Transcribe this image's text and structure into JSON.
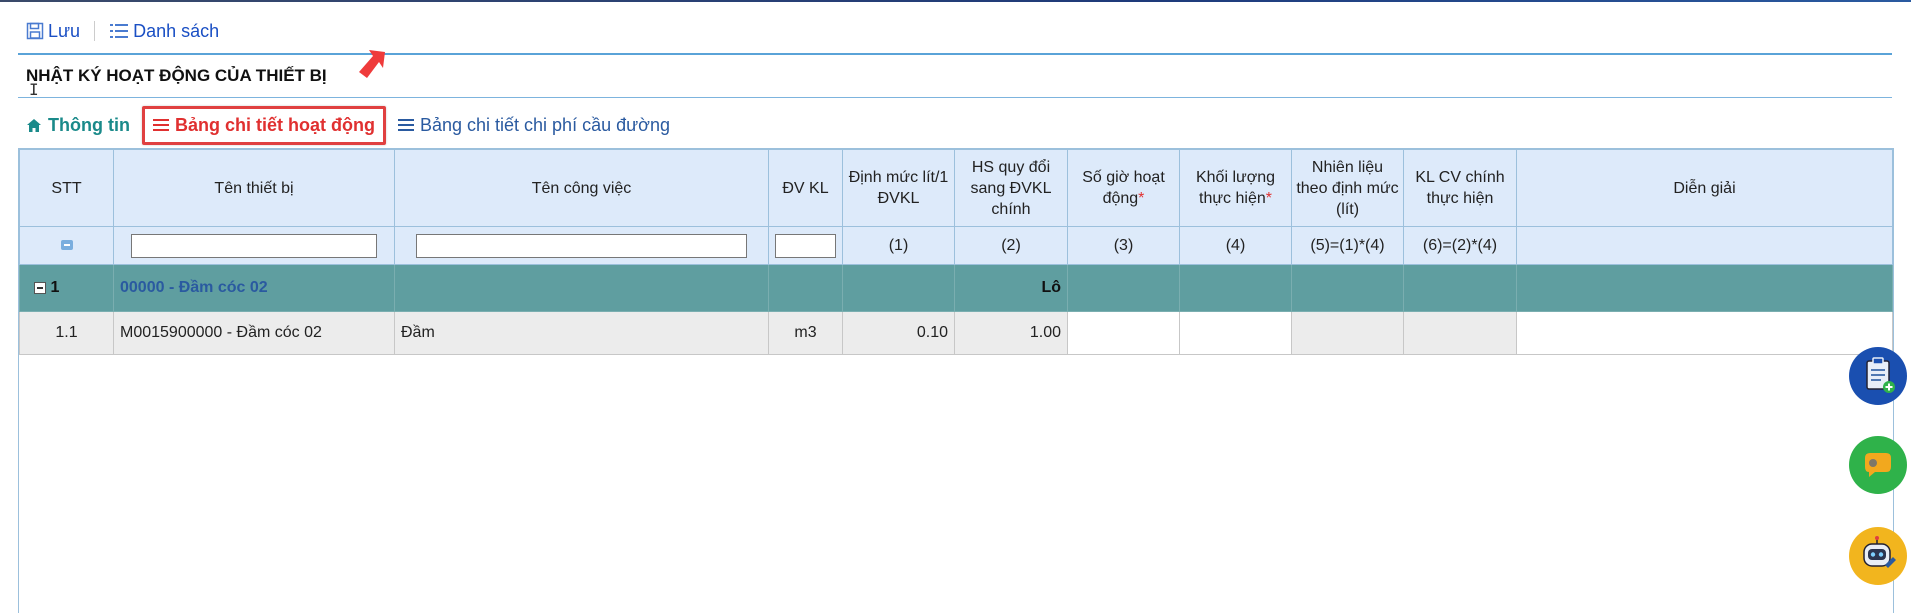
{
  "toolbar": {
    "save_label": "Lưu",
    "list_label": "Danh sách"
  },
  "page_title": "NHẬT KÝ HOẠT ĐỘNG CỦA THIẾT BỊ",
  "tabs": [
    {
      "label": "Thông tin",
      "icon": "home-icon"
    },
    {
      "label": "Bảng chi tiết hoạt động",
      "icon": "list-icon"
    },
    {
      "label": "Bảng chi tiết chi phí cầu đường",
      "icon": "list-icon"
    }
  ],
  "table": {
    "headers": {
      "stt": "STT",
      "device": "Tên thiết bị",
      "work": "Tên công việc",
      "unit": "ĐV KL",
      "norm": "Định mức lít/1 ĐVKL",
      "coef": "HS quy đổi sang ĐVKL chính",
      "hours": "Số giờ hoạt động",
      "volume": "Khối lượng thực hiện",
      "fuel": "Nhiên liệu theo định mức (lít)",
      "klcv": "KL CV chính thực hiện",
      "desc": "Diễn giải"
    },
    "required_mark": "*",
    "filter_row": {
      "norm": "(1)",
      "coef": "(2)",
      "hours": "(3)",
      "volume": "(4)",
      "fuel": "(5)=(1)*(4)",
      "klcv": "(6)=(2)*(4)"
    },
    "group": {
      "stt": "1",
      "name": "00000 - Đầm cóc 02",
      "lot": "Lô"
    },
    "rows": [
      {
        "stt": "1.1",
        "device": "M0015900000 - Đầm cóc 02",
        "work": "Đầm",
        "unit": "m3",
        "norm": "0.10",
        "coef": "1.00"
      }
    ]
  },
  "colors": {
    "accent": "#1a4fc4",
    "group_bg": "#5f9ea0",
    "active_tab": "#e03030",
    "header_bg": "#ddeafa"
  }
}
